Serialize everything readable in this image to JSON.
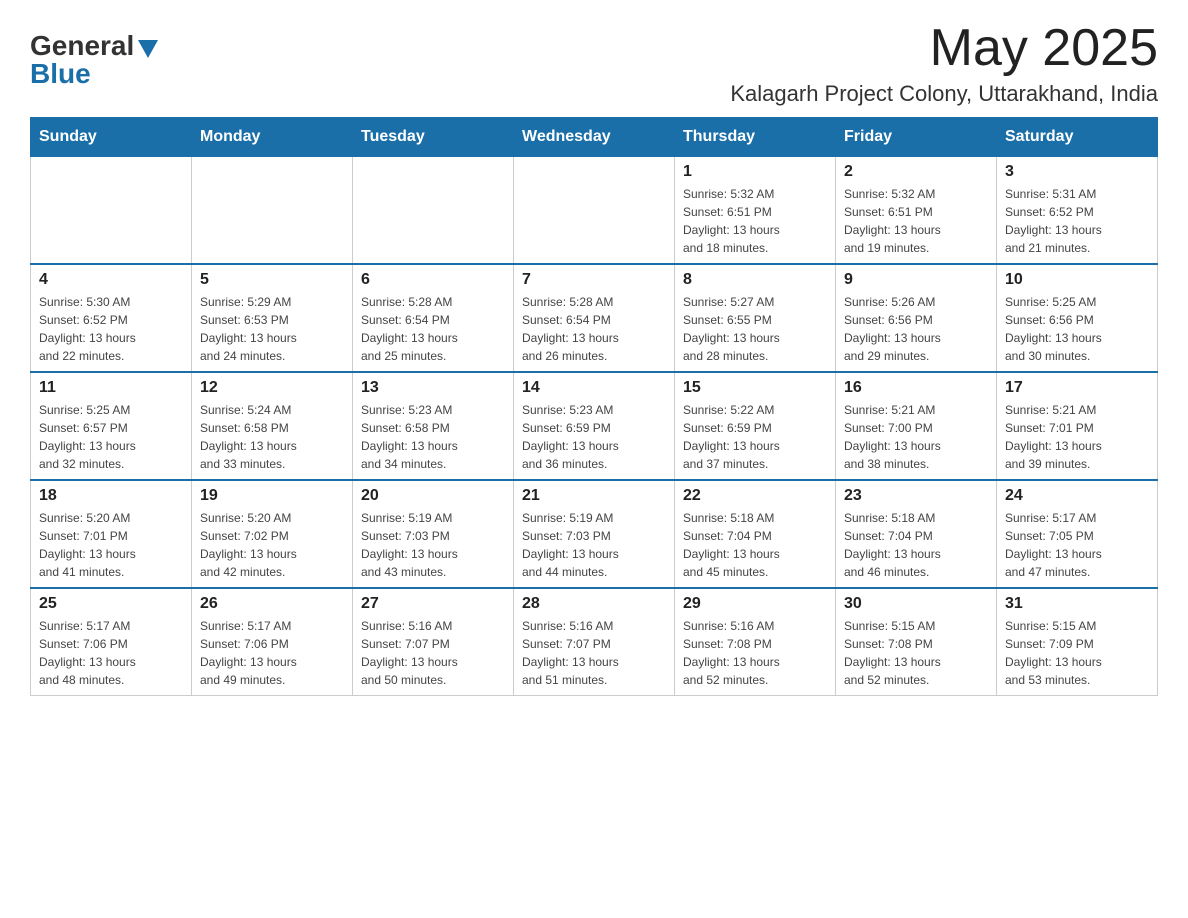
{
  "header": {
    "logo_general": "General",
    "logo_blue": "Blue",
    "month_title": "May 2025",
    "location": "Kalagarh Project Colony, Uttarakhand, India"
  },
  "weekdays": [
    "Sunday",
    "Monday",
    "Tuesday",
    "Wednesday",
    "Thursday",
    "Friday",
    "Saturday"
  ],
  "weeks": [
    [
      {
        "day": "",
        "info": ""
      },
      {
        "day": "",
        "info": ""
      },
      {
        "day": "",
        "info": ""
      },
      {
        "day": "",
        "info": ""
      },
      {
        "day": "1",
        "info": "Sunrise: 5:32 AM\nSunset: 6:51 PM\nDaylight: 13 hours\nand 18 minutes."
      },
      {
        "day": "2",
        "info": "Sunrise: 5:32 AM\nSunset: 6:51 PM\nDaylight: 13 hours\nand 19 minutes."
      },
      {
        "day": "3",
        "info": "Sunrise: 5:31 AM\nSunset: 6:52 PM\nDaylight: 13 hours\nand 21 minutes."
      }
    ],
    [
      {
        "day": "4",
        "info": "Sunrise: 5:30 AM\nSunset: 6:52 PM\nDaylight: 13 hours\nand 22 minutes."
      },
      {
        "day": "5",
        "info": "Sunrise: 5:29 AM\nSunset: 6:53 PM\nDaylight: 13 hours\nand 24 minutes."
      },
      {
        "day": "6",
        "info": "Sunrise: 5:28 AM\nSunset: 6:54 PM\nDaylight: 13 hours\nand 25 minutes."
      },
      {
        "day": "7",
        "info": "Sunrise: 5:28 AM\nSunset: 6:54 PM\nDaylight: 13 hours\nand 26 minutes."
      },
      {
        "day": "8",
        "info": "Sunrise: 5:27 AM\nSunset: 6:55 PM\nDaylight: 13 hours\nand 28 minutes."
      },
      {
        "day": "9",
        "info": "Sunrise: 5:26 AM\nSunset: 6:56 PM\nDaylight: 13 hours\nand 29 minutes."
      },
      {
        "day": "10",
        "info": "Sunrise: 5:25 AM\nSunset: 6:56 PM\nDaylight: 13 hours\nand 30 minutes."
      }
    ],
    [
      {
        "day": "11",
        "info": "Sunrise: 5:25 AM\nSunset: 6:57 PM\nDaylight: 13 hours\nand 32 minutes."
      },
      {
        "day": "12",
        "info": "Sunrise: 5:24 AM\nSunset: 6:58 PM\nDaylight: 13 hours\nand 33 minutes."
      },
      {
        "day": "13",
        "info": "Sunrise: 5:23 AM\nSunset: 6:58 PM\nDaylight: 13 hours\nand 34 minutes."
      },
      {
        "day": "14",
        "info": "Sunrise: 5:23 AM\nSunset: 6:59 PM\nDaylight: 13 hours\nand 36 minutes."
      },
      {
        "day": "15",
        "info": "Sunrise: 5:22 AM\nSunset: 6:59 PM\nDaylight: 13 hours\nand 37 minutes."
      },
      {
        "day": "16",
        "info": "Sunrise: 5:21 AM\nSunset: 7:00 PM\nDaylight: 13 hours\nand 38 minutes."
      },
      {
        "day": "17",
        "info": "Sunrise: 5:21 AM\nSunset: 7:01 PM\nDaylight: 13 hours\nand 39 minutes."
      }
    ],
    [
      {
        "day": "18",
        "info": "Sunrise: 5:20 AM\nSunset: 7:01 PM\nDaylight: 13 hours\nand 41 minutes."
      },
      {
        "day": "19",
        "info": "Sunrise: 5:20 AM\nSunset: 7:02 PM\nDaylight: 13 hours\nand 42 minutes."
      },
      {
        "day": "20",
        "info": "Sunrise: 5:19 AM\nSunset: 7:03 PM\nDaylight: 13 hours\nand 43 minutes."
      },
      {
        "day": "21",
        "info": "Sunrise: 5:19 AM\nSunset: 7:03 PM\nDaylight: 13 hours\nand 44 minutes."
      },
      {
        "day": "22",
        "info": "Sunrise: 5:18 AM\nSunset: 7:04 PM\nDaylight: 13 hours\nand 45 minutes."
      },
      {
        "day": "23",
        "info": "Sunrise: 5:18 AM\nSunset: 7:04 PM\nDaylight: 13 hours\nand 46 minutes."
      },
      {
        "day": "24",
        "info": "Sunrise: 5:17 AM\nSunset: 7:05 PM\nDaylight: 13 hours\nand 47 minutes."
      }
    ],
    [
      {
        "day": "25",
        "info": "Sunrise: 5:17 AM\nSunset: 7:06 PM\nDaylight: 13 hours\nand 48 minutes."
      },
      {
        "day": "26",
        "info": "Sunrise: 5:17 AM\nSunset: 7:06 PM\nDaylight: 13 hours\nand 49 minutes."
      },
      {
        "day": "27",
        "info": "Sunrise: 5:16 AM\nSunset: 7:07 PM\nDaylight: 13 hours\nand 50 minutes."
      },
      {
        "day": "28",
        "info": "Sunrise: 5:16 AM\nSunset: 7:07 PM\nDaylight: 13 hours\nand 51 minutes."
      },
      {
        "day": "29",
        "info": "Sunrise: 5:16 AM\nSunset: 7:08 PM\nDaylight: 13 hours\nand 52 minutes."
      },
      {
        "day": "30",
        "info": "Sunrise: 5:15 AM\nSunset: 7:08 PM\nDaylight: 13 hours\nand 52 minutes."
      },
      {
        "day": "31",
        "info": "Sunrise: 5:15 AM\nSunset: 7:09 PM\nDaylight: 13 hours\nand 53 minutes."
      }
    ]
  ]
}
